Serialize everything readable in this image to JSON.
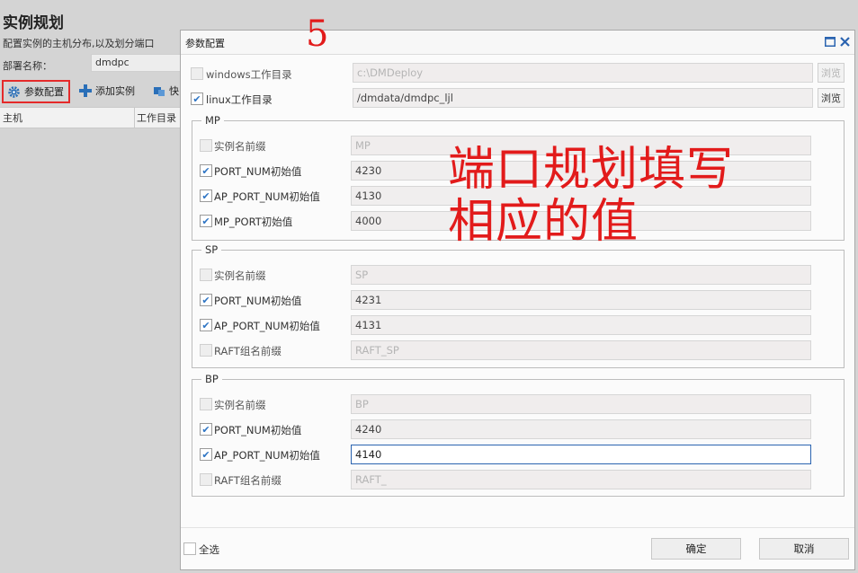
{
  "background": {
    "title": "实例规划",
    "subtitle": "配置实例的主机分布,以及划分端口",
    "deploy_label": "部署名称：",
    "deploy_value": "dmdpc",
    "toolbar": {
      "params_label": "参数配置",
      "add_label": "添加实例",
      "more_label": "快"
    },
    "table_headers": {
      "host": "主机",
      "workdir": "工作目录"
    }
  },
  "annotations": {
    "step_number": "5",
    "note_line1": "端口规划填写",
    "note_line2": "相应的值",
    "color": "#e21b1b"
  },
  "dialog": {
    "title": "参数配置",
    "windows_dir": {
      "label": "windows工作目录",
      "checked": false,
      "value": "c:\\DMDeploy",
      "browse": "浏览"
    },
    "linux_dir": {
      "label": "linux工作目录",
      "checked": true,
      "value": "/dmdata/dmdpc_ljl",
      "browse": "浏览"
    },
    "groups": {
      "mp": {
        "legend": "MP",
        "rows": [
          {
            "label": "实例名前缀",
            "checked": false,
            "value": "MP"
          },
          {
            "label": "PORT_NUM初始值",
            "checked": true,
            "value": "4230"
          },
          {
            "label": "AP_PORT_NUM初始值",
            "checked": true,
            "value": "4130"
          },
          {
            "label": "MP_PORT初始值",
            "checked": true,
            "value": "4000"
          }
        ]
      },
      "sp": {
        "legend": "SP",
        "rows": [
          {
            "label": "实例名前缀",
            "checked": false,
            "value": "SP"
          },
          {
            "label": "PORT_NUM初始值",
            "checked": true,
            "value": "4231"
          },
          {
            "label": "AP_PORT_NUM初始值",
            "checked": true,
            "value": "4131"
          },
          {
            "label": "RAFT组名前缀",
            "checked": false,
            "value": "RAFT_SP"
          }
        ]
      },
      "bp": {
        "legend": "BP",
        "rows": [
          {
            "label": "实例名前缀",
            "checked": false,
            "value": "BP"
          },
          {
            "label": "PORT_NUM初始值",
            "checked": true,
            "value": "4240"
          },
          {
            "label": "AP_PORT_NUM初始值",
            "checked": true,
            "value": "4140"
          },
          {
            "label": "RAFT组名前缀",
            "checked": false,
            "value": "RAFT_"
          }
        ]
      }
    },
    "footer": {
      "select_all": "全选",
      "ok": "确定",
      "cancel": "取消"
    }
  },
  "colors": {
    "accent": "#2b64b0",
    "highlight_box": "#e52a2a",
    "check": "#2d74c4"
  }
}
